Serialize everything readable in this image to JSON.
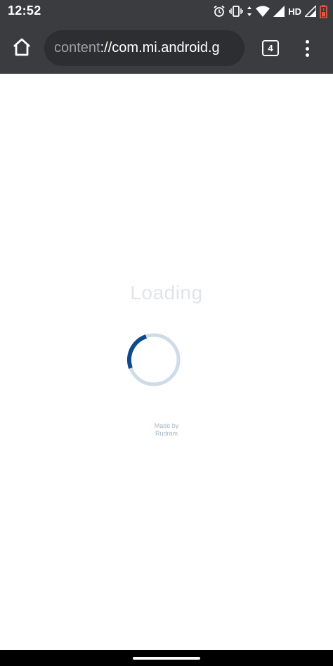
{
  "status_bar": {
    "time": "12:52",
    "network_label": "HD",
    "icons": [
      "alarm-icon",
      "vibrate-icon",
      "data-arrows-icon",
      "wifi-icon",
      "signal-icon",
      "signal-icon",
      "battery-icon"
    ],
    "battery_color": "#e8563f"
  },
  "browser": {
    "url_scheme": "content",
    "url_rest": "://com.mi.android.g",
    "tab_count": "4",
    "home_icon": "home-icon",
    "menu_icon": "more-vert-icon"
  },
  "page": {
    "loading_title": "Loading",
    "credit_line1": "Made by",
    "credit_line2": "Rudram",
    "spinner_track_color": "#cfdbe8",
    "spinner_arc_color": "#0d4a8c"
  }
}
